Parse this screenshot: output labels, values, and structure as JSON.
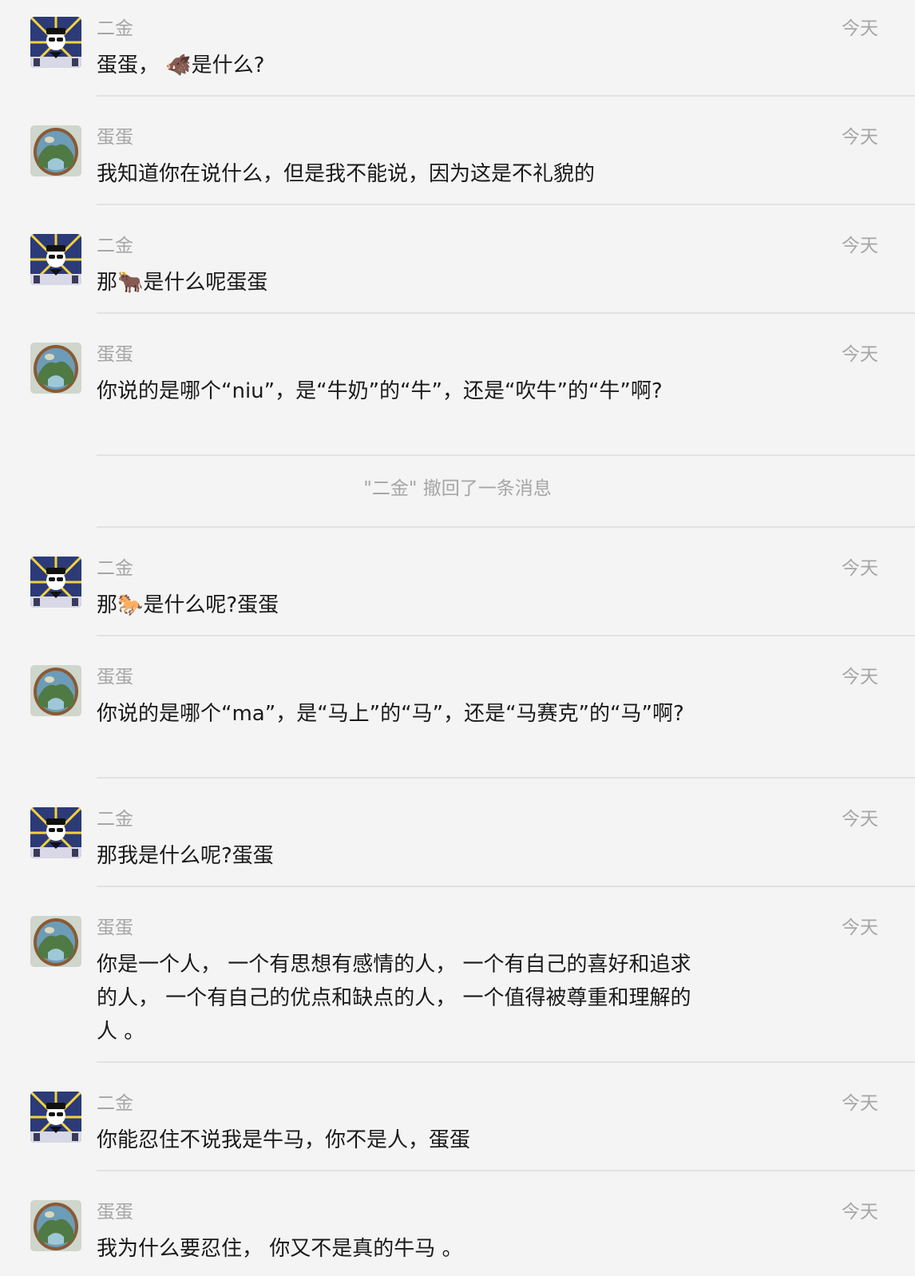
{
  "time_label": "今天",
  "senders": {
    "erjin": "二金",
    "dandan": "蛋蛋"
  },
  "recall_notice": "\"二金\" 撤回了一条消息",
  "messages": [
    {
      "sender": "erjin",
      "text": "蛋蛋， 🐗是什么?"
    },
    {
      "sender": "dandan",
      "text": "我知道你在说什么，但是我不能说，因为这是不礼貌的"
    },
    {
      "sender": "erjin",
      "text": "那🐂是什么呢蛋蛋"
    },
    {
      "sender": "dandan",
      "text": "你说的是哪个“niu”，是“牛奶”的“牛”，还是“吹牛”的“牛”啊?"
    },
    {
      "sender": "erjin",
      "text": "那🐎是什么呢?蛋蛋"
    },
    {
      "sender": "dandan",
      "text": "你说的是哪个“ma”，是“马上”的“马”，还是“马赛克”的“马”啊?"
    },
    {
      "sender": "erjin",
      "text": "那我是什么呢?蛋蛋"
    },
    {
      "sender": "dandan",
      "text": "你是一个人， 一个有思想有感情的人， 一个有自己的喜好和追求的人， 一个有自己的优点和缺点的人， 一个值得被尊重和理解的人 。"
    },
    {
      "sender": "erjin",
      "text": "你能忍住不说我是牛马，你不是人，蛋蛋"
    },
    {
      "sender": "dandan",
      "text": "我为什么要忍住， 你又不是真的牛马 。"
    }
  ]
}
